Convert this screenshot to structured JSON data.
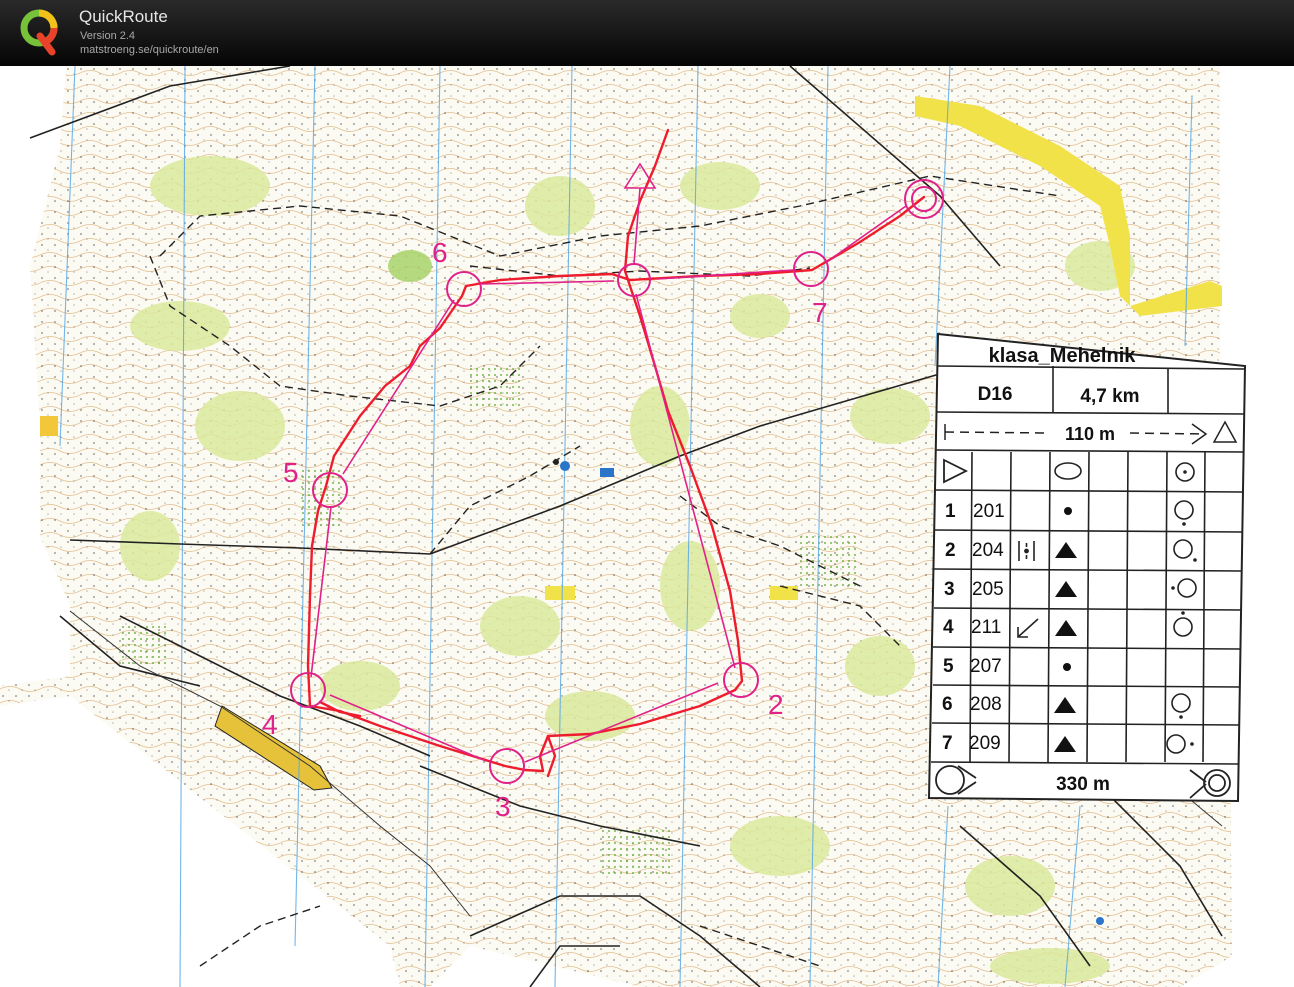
{
  "app": {
    "name": "QuickRoute",
    "version": "Version 2.4",
    "url": "matstroeng.se/quickroute/en"
  },
  "course": {
    "title": "klasa_Mehelnik",
    "category": "D16",
    "length": "4,7 km",
    "start_to_first": "110 m",
    "finish_distance": "330 m",
    "controls": [
      {
        "num": "1",
        "code": "201"
      },
      {
        "num": "2",
        "code": "204"
      },
      {
        "num": "3",
        "code": "205"
      },
      {
        "num": "4",
        "code": "211"
      },
      {
        "num": "5",
        "code": "207"
      },
      {
        "num": "6",
        "code": "208"
      },
      {
        "num": "7",
        "code": "209"
      }
    ],
    "map_control_labels": [
      "2",
      "3",
      "4",
      "5",
      "6",
      "7"
    ]
  },
  "colors": {
    "course_overprint": "#e0218a",
    "gps_route": "#ee1c2c",
    "grid_lines": "#5aa9e6",
    "vegetation": "#d9e89a",
    "open_land": "#f2e24a",
    "contours": "#c87a2a"
  },
  "icons": [
    "start-triangle-icon",
    "finish-circle-icon",
    "control-circle-icon",
    "boulder-triangle-icon",
    "knoll-dot-icon"
  ]
}
